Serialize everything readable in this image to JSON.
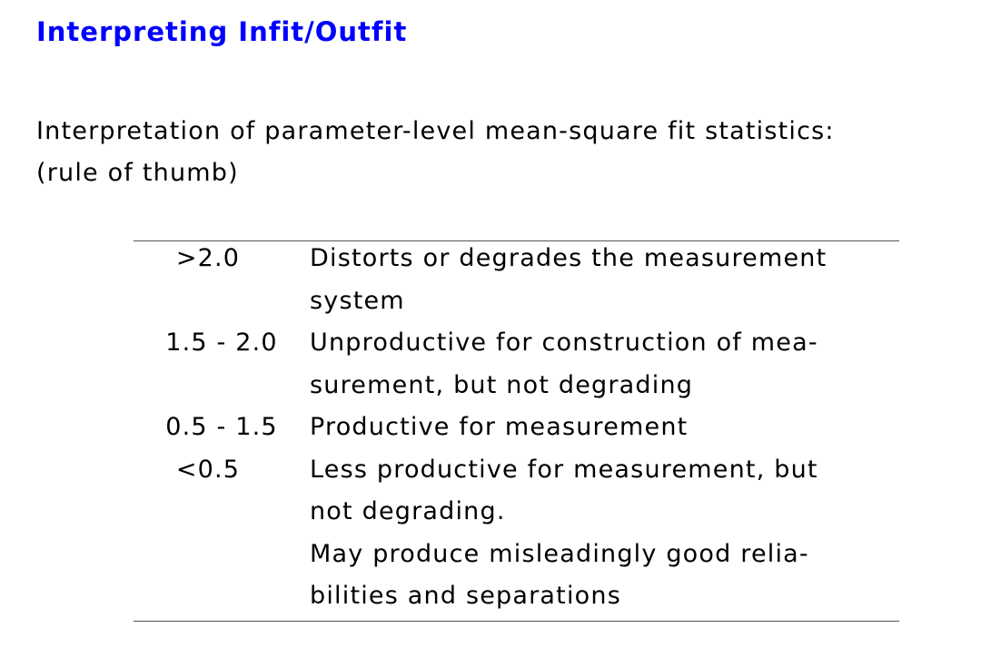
{
  "title": "Interpreting Infit/Outfit",
  "intro": [
    "Interpretation of parameter-level mean-square fit statistics:",
    "(rule of thumb)"
  ],
  "table": {
    "rows": [
      {
        "range": ">2.0",
        "lines": [
          "Distorts or degrades the measurement",
          "system"
        ]
      },
      {
        "range": "1.5 - 2.0",
        "lines": [
          "Unproductive for construction of mea-",
          "surement, but not degrading"
        ]
      },
      {
        "range": "0.5 - 1.5",
        "lines": [
          "Productive for measurement"
        ]
      },
      {
        "range": "<0.5",
        "lines": [
          "Less productive for measurement, but",
          "not degrading.",
          "May produce misleadingly good relia-",
          "bilities and separations"
        ]
      }
    ]
  },
  "colors": {
    "title": "#0000ff"
  }
}
